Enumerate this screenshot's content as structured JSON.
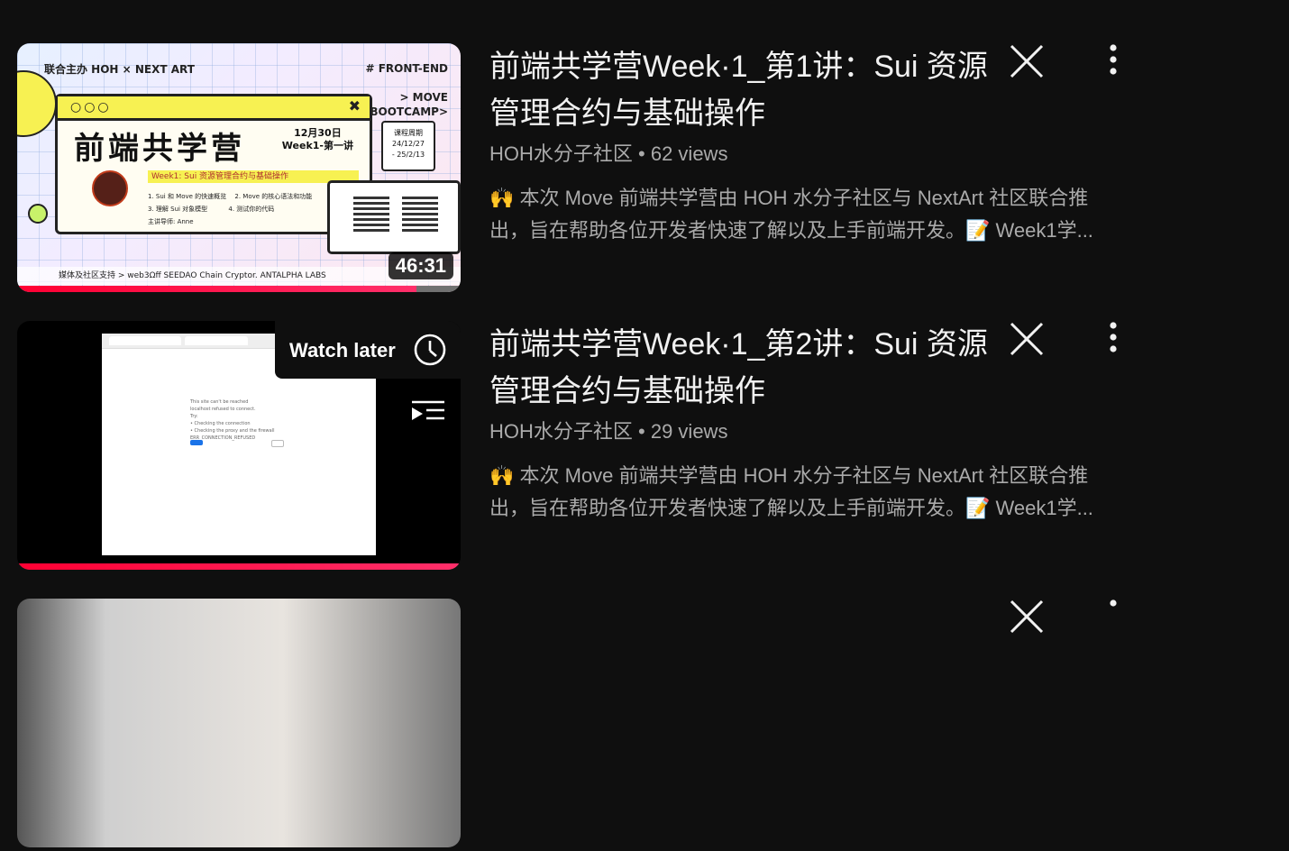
{
  "videos": [
    {
      "title": "前端共学营Week·1_第1讲：Sui 资源管理合约与基础操作",
      "channel": "HOH水分子社区",
      "separator": "•",
      "views": "62 views",
      "desc_line1": "🙌 本次 Move 前端共学营由 HOH 水分子社区与 NextArt 社区联合推",
      "desc_line2": "出，旨在帮助各位开发者快速了解以及上手前端开发。📝 Week1学...",
      "duration": "46:31",
      "progress_fraction": 0.9,
      "thumb": {
        "org_label": "联合主办 HOH × NEXT ART",
        "tag_right_1": "# FRONT-END",
        "tag_right_2": "> MOVE",
        "tag_right_3": "BOOTCAMP>",
        "dots": "○○○",
        "x_mark": "✖",
        "big_title": "前端共学营",
        "date_1": "12月30日",
        "date_2": "Week1-第一讲",
        "week_strip": "Week1: Sui 资源管理合约与基础操作",
        "line_1": "1. Sui 和 Move 的快速概览　 2. Move 的核心语法和功能",
        "line_2": "3. 理解 Sui 对象模型　　　 4. 测试你的代码",
        "line_3": "主讲导师: Anne",
        "calendar_1": "课程周期",
        "calendar_2": "24/12/27",
        "calendar_3": "- 25/2/13",
        "bottom_strip": "媒体及社区支持 > web3Ωff  SEEDAO  Chain  Cryptor.  ANTALPHA LABS"
      }
    },
    {
      "title": "前端共学营Week·1_第2讲：Sui 资源管理合约与基础操作",
      "channel": "HOH水分子社区",
      "separator": "•",
      "views": "29 views",
      "desc_line1": "🙌 本次 Move 前端共学营由 HOH 水分子社区与 NextArt 社区联合推",
      "desc_line2": "出，旨在帮助各位开发者快速了解以及上手前端开发。📝 Week1学...",
      "progress_fraction": 1.0,
      "watch_later_label": "Watch later",
      "thumb": {
        "page_line_1": "This site can't be reached",
        "page_line_2": "localhost refused to connect.",
        "page_line_3": "Try:",
        "page_line_4": "• Checking the connection",
        "page_line_5": "• Checking the proxy and the firewall",
        "page_line_6": "ERR_CONNECTION_REFUSED"
      }
    }
  ],
  "colors": {
    "background": "#0f0f0f",
    "title": "#f1f1f1",
    "meta": "#aaaaaa",
    "progress": "#ff0033"
  },
  "icons": {
    "dismiss": "close-icon",
    "more": "more-vert-icon",
    "watch_later": "clock-icon",
    "add_to_queue": "queue-icon"
  }
}
